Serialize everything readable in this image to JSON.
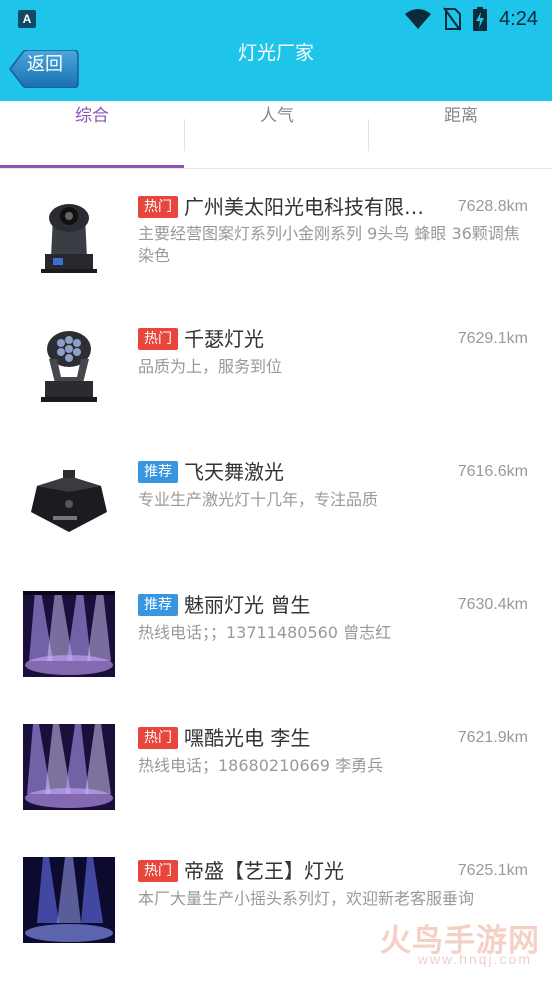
{
  "status_bar": {
    "app_badge": "A",
    "time": "4:24",
    "icons": [
      "wifi-icon",
      "no-sim-icon",
      "battery-charging-icon"
    ]
  },
  "navbar": {
    "back_label": "返回",
    "title": "灯光厂家"
  },
  "tabs": [
    {
      "label": "综合",
      "active": true
    },
    {
      "label": "人气",
      "active": false
    },
    {
      "label": "距离",
      "active": false
    }
  ],
  "colors": {
    "header_bg": "#1ec4ea",
    "accent": "#8a56b5",
    "hot_badge": "#e8453c",
    "recommend_badge": "#3896e0"
  },
  "items": [
    {
      "badge": "热门",
      "badge_type": "hot",
      "name": "广州美太阳光电科技有限公司",
      "distance": "7628.8km",
      "description": "主要经营图案灯系列小金刚系列 9头鸟 蜂眼 36颗调焦染色",
      "thumbnail": "moving-head-light-image"
    },
    {
      "badge": "热门",
      "badge_type": "hot",
      "name": "千瑟灯光",
      "distance": "7629.1km",
      "description": "品质为上，服务到位",
      "thumbnail": "bee-eye-moving-head-image"
    },
    {
      "badge": "推荐",
      "badge_type": "rec",
      "name": "飞天舞激光",
      "distance": "7616.6km",
      "description": "专业生产激光灯十几年，专注品质",
      "thumbnail": "laser-light-image"
    },
    {
      "badge": "推荐",
      "badge_type": "rec",
      "name": "魅丽灯光 曾生",
      "distance": "7630.4km",
      "description": "热线电话；；13711480560 曾志红",
      "thumbnail": "stage-lighting-image"
    },
    {
      "badge": "热门",
      "badge_type": "hot",
      "name": "嘿酷光电  李生",
      "distance": "7621.9km",
      "description": "热线电话；18680210669 李勇兵",
      "thumbnail": "stage-lighting-image"
    },
    {
      "badge": "热门",
      "badge_type": "hot",
      "name": "帝盛【艺王】灯光",
      "distance": "7625.1km",
      "description": "本厂大量生产小摇头系列灯，欢迎新老客服垂询",
      "thumbnail": "stage-beam-image"
    }
  ],
  "watermark": {
    "main": "火鸟手游网",
    "sub": "www.hnqj.com"
  }
}
